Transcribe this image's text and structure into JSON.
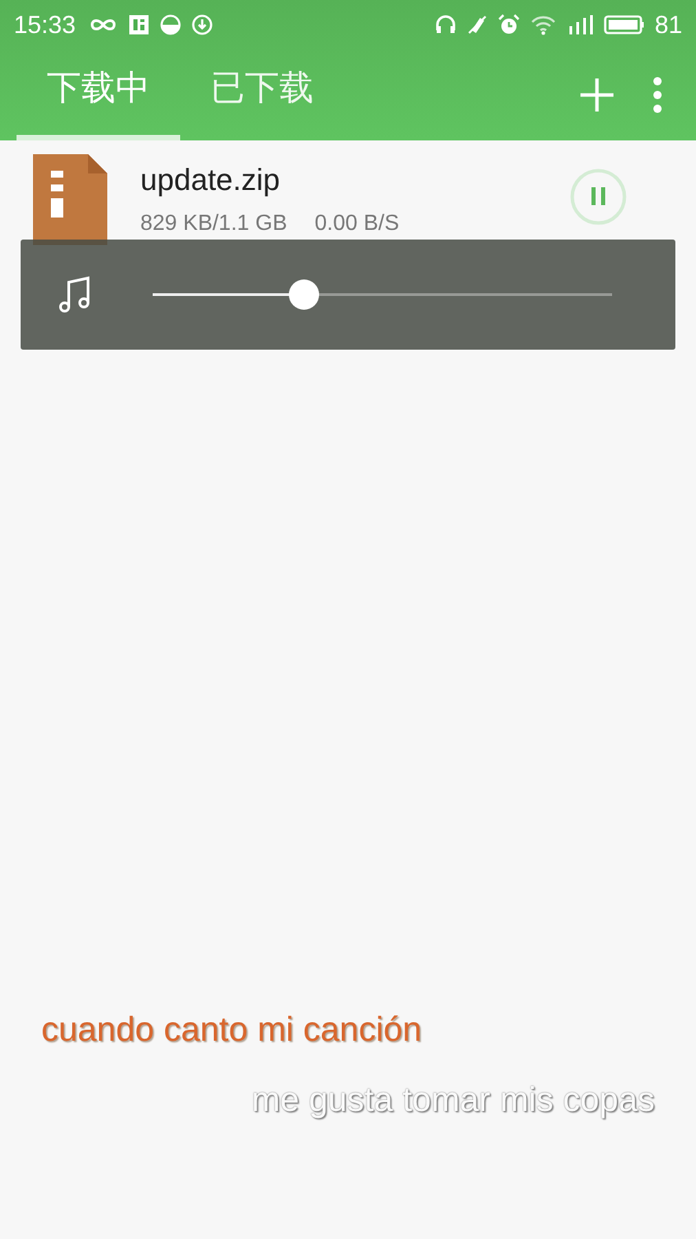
{
  "status_bar": {
    "time": "15:33",
    "battery_text": "81"
  },
  "tabs": [
    {
      "label": "下载中",
      "selected": true
    },
    {
      "label": "已下载",
      "selected": false
    }
  ],
  "downloads": [
    {
      "name": "update.zip",
      "progress": "829 KB/1.1 GB",
      "speed": "0.00 B/S",
      "paused": false
    }
  ],
  "volume": {
    "level": 0.33
  },
  "lyrics": [
    {
      "text": "cuando canto mi canción",
      "active": true
    },
    {
      "text": "me gusta tomar mis copas",
      "active": false
    }
  ]
}
